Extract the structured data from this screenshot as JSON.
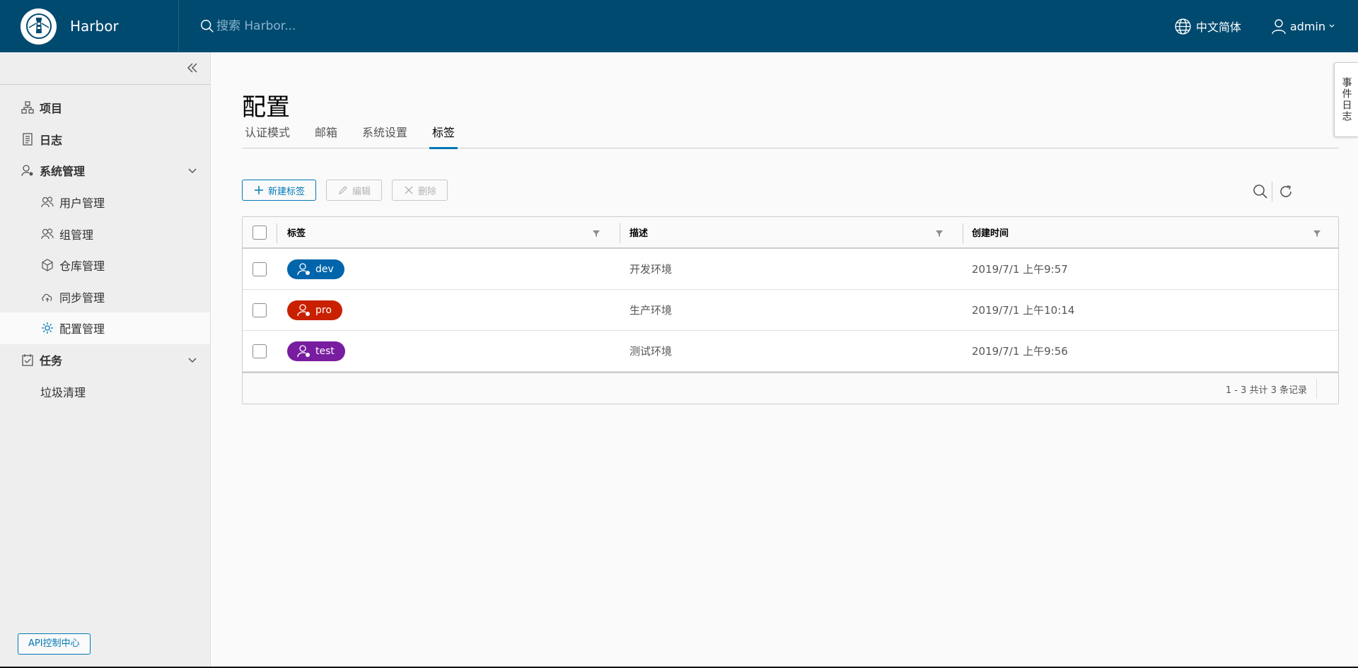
{
  "header": {
    "brand": "Harbor",
    "search_placeholder": "搜索 Harbor...",
    "language": "中文简体",
    "user": "admin"
  },
  "sidebar": {
    "items": [
      {
        "label": "项目",
        "icon": "project-icon"
      },
      {
        "label": "日志",
        "icon": "log-icon"
      },
      {
        "label": "系统管理",
        "icon": "admin-icon"
      }
    ],
    "admin_children": [
      {
        "label": "用户管理",
        "icon": "users-icon"
      },
      {
        "label": "组管理",
        "icon": "groups-icon"
      },
      {
        "label": "仓库管理",
        "icon": "registry-icon"
      },
      {
        "label": "同步管理",
        "icon": "replication-icon"
      },
      {
        "label": "配置管理",
        "icon": "gear-icon"
      }
    ],
    "tasks": {
      "label": "任务",
      "icon": "tasks-icon"
    },
    "tasks_children": [
      {
        "label": "垃圾清理"
      }
    ],
    "api_button": "API控制中心"
  },
  "main": {
    "title": "配置",
    "tabs": [
      "认证模式",
      "邮箱",
      "系统设置",
      "标签"
    ],
    "active_tab": "标签",
    "toolbar": {
      "new": "新建标签",
      "edit": "编辑",
      "delete": "删除"
    },
    "columns": [
      "标签",
      "描述",
      "创建时间"
    ],
    "rows": [
      {
        "label": "dev",
        "color": "#0065ab",
        "desc": "开发环境",
        "time": "2019/7/1 上午9:57"
      },
      {
        "label": "pro",
        "color": "#c92100",
        "desc": "生产环境",
        "time": "2019/7/1 上午10:14"
      },
      {
        "label": "test",
        "color": "#781da0",
        "desc": "测试环境",
        "time": "2019/7/1 上午9:56"
      }
    ],
    "footer": "1 - 3 共计 3 条记录"
  },
  "event_tab": "事件日志",
  "colors": {
    "header": "#004a70",
    "accent": "#0079b8",
    "sidebar": "#eeeeee"
  }
}
